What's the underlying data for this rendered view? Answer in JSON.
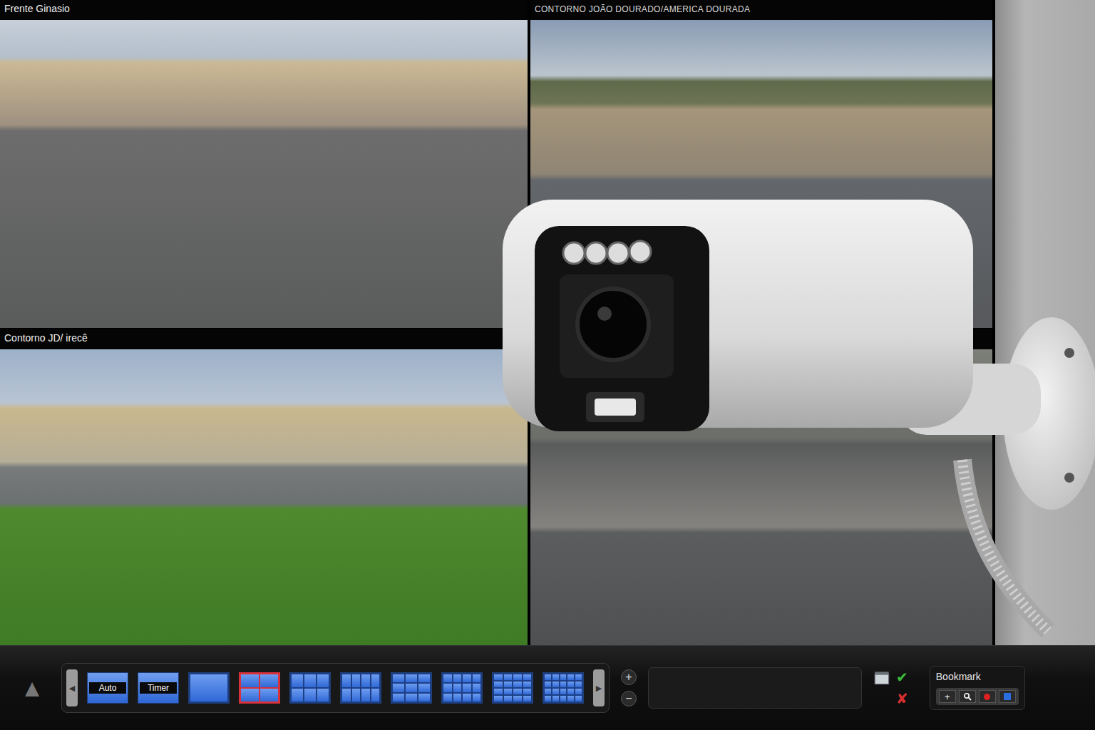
{
  "cameras": [
    {
      "label": "Frente Ginasio"
    },
    {
      "label": "CONTORNO JOÃO DOURADO/AMERICA DOURADA"
    },
    {
      "label": "Contorno JD/ irecê"
    },
    {}
  ],
  "toolbar": {
    "collapse": "▲",
    "scroll_left": "◀",
    "scroll_right": "▶",
    "layouts": [
      {
        "kind": "text",
        "label": "Auto",
        "selected": false
      },
      {
        "kind": "text",
        "label": "Timer",
        "selected": false
      },
      {
        "kind": "grid",
        "selected": false
      },
      {
        "kind": "grid",
        "selected": true
      },
      {
        "kind": "grid",
        "selected": false
      },
      {
        "kind": "grid",
        "selected": false
      },
      {
        "kind": "grid",
        "selected": false
      },
      {
        "kind": "grid",
        "selected": false
      },
      {
        "kind": "grid",
        "selected": false
      },
      {
        "kind": "grid",
        "selected": false
      }
    ],
    "zoom_in": "+",
    "zoom_out": "−",
    "field": "",
    "confirm": "✔",
    "cancel": "✘",
    "bookmark": {
      "title": "Bookmark",
      "add": "+"
    }
  }
}
